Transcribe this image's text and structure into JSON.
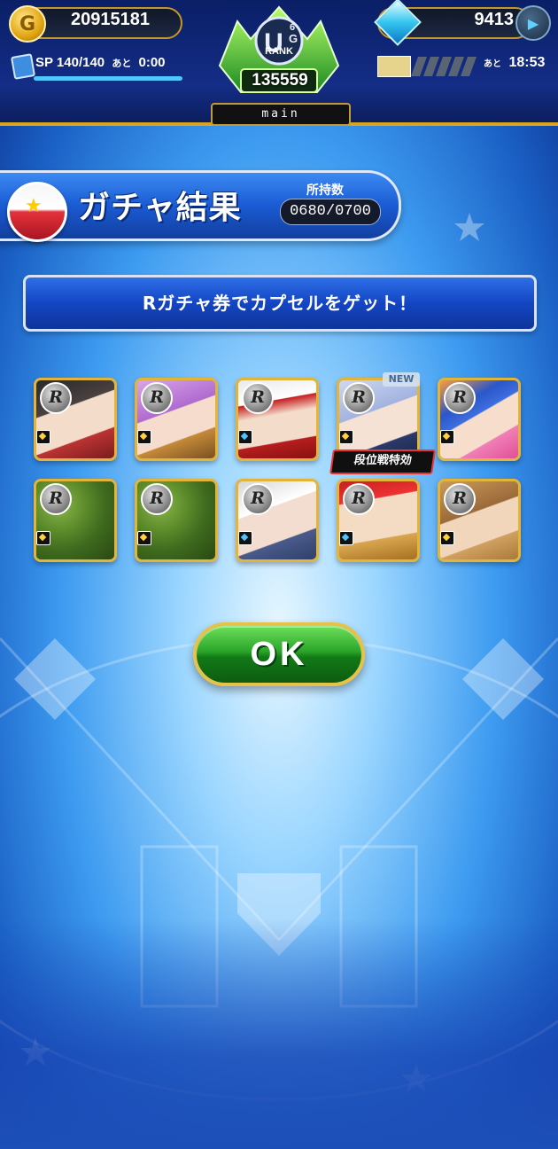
{
  "header": {
    "coins": "20915181",
    "coin_icon_glyph": "G",
    "gems": "9413",
    "sp_label": "SP",
    "sp_value": "140/140",
    "sp_ato": "あと",
    "sp_time": "0:00",
    "sp_progress": 1.0,
    "rank_label": "RANK",
    "rank_points": "135559",
    "account_name": "main",
    "timer_ato": "あと",
    "timer": "18:53"
  },
  "title": {
    "text": "ガチャ結果",
    "owned_label": "所持数",
    "owned_value": "0680/0700"
  },
  "message": "Rガチャ券でカプセルをゲット！",
  "cards": [
    {
      "rarity": "R",
      "position": "yellow",
      "theme": "ninja"
    },
    {
      "rarity": "R",
      "position": "yellow",
      "theme": "purple-hair"
    },
    {
      "rarity": "R",
      "position": "blue",
      "theme": "red-cap"
    },
    {
      "rarity": "R",
      "position": "yellow",
      "theme": "silver-hair"
    },
    {
      "rarity": "R",
      "position": "yellow",
      "theme": "blue-hair"
    },
    {
      "rarity": "R",
      "position": "yellow",
      "theme": "camo"
    },
    {
      "rarity": "R",
      "position": "yellow",
      "theme": "camo"
    },
    {
      "rarity": "R",
      "position": "blue",
      "theme": "white-hair"
    },
    {
      "rarity": "R",
      "position": "blue",
      "theme": "red-cap-2"
    },
    {
      "rarity": "R",
      "position": "yellow",
      "theme": "brown-hair"
    }
  ],
  "card_tag": "段位戦特効",
  "new_badge": "NEW",
  "ok_button": "OK",
  "colors": {
    "accent_gold": "#e2b53a",
    "banner_blue": "#1a5bd4",
    "ok_green": "#2aa52a"
  }
}
